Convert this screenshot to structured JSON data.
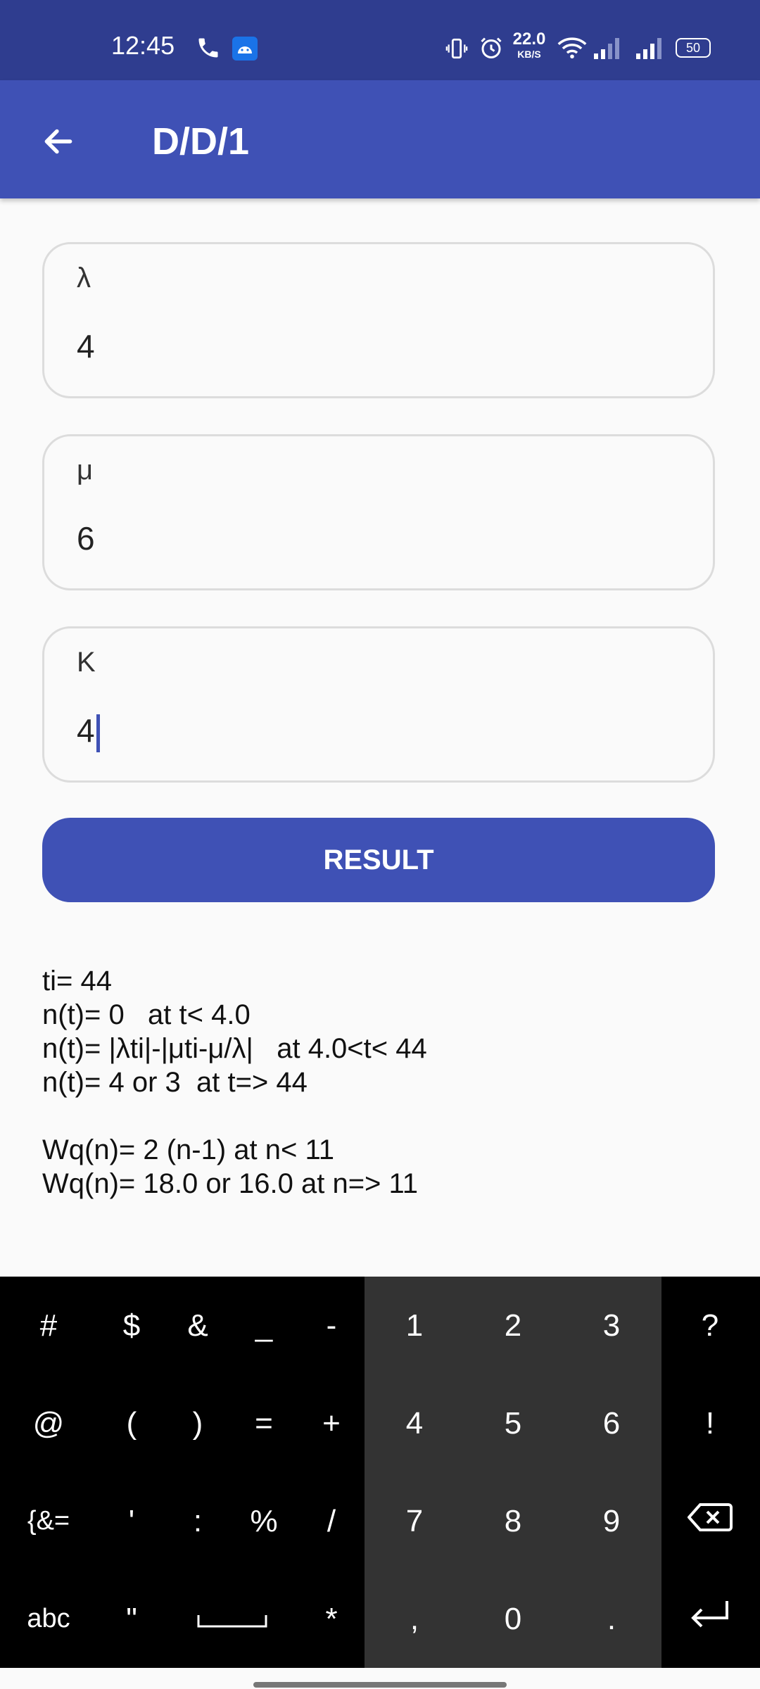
{
  "status_bar": {
    "time": "12:45",
    "net_speed_value": "22.0",
    "net_speed_unit": "KB/S",
    "battery": "50"
  },
  "app_bar": {
    "title": "D/D/1"
  },
  "form": {
    "lambda": {
      "label": "λ",
      "value": "4"
    },
    "mu": {
      "label": "μ",
      "value": "6"
    },
    "k": {
      "label": "K",
      "value": "4"
    }
  },
  "result_button": {
    "label": "RESULT"
  },
  "output": {
    "lines": [
      "ti= 44",
      "n(t)= 0   at t< 4.0",
      "n(t)= |λti|-|μti-μ/λ|   at 4.0<t< 44",
      "n(t)= 4 or 3  at t=> 44",
      "",
      "Wq(n)= 2 (n-1) at n< 11",
      "Wq(n)= 18.0 or 16.0 at n=> 11"
    ]
  },
  "keyboard": {
    "rows": [
      [
        "#",
        "$",
        "&",
        "_",
        "-",
        "1",
        "2",
        "3",
        "?"
      ],
      [
        "@",
        "(",
        ")",
        "=",
        "+",
        "4",
        "5",
        "6",
        "!"
      ],
      [
        "{&=",
        "'",
        ":",
        "%",
        "/",
        "7",
        "8",
        "9",
        "⌫"
      ],
      [
        "abc",
        "\"",
        "␣",
        "*",
        ",",
        "0",
        ".",
        "↵"
      ]
    ]
  },
  "colors": {
    "status_bar": "#2f3d8f",
    "app_bar": "#3f51b5",
    "accent": "#3f51b5"
  }
}
